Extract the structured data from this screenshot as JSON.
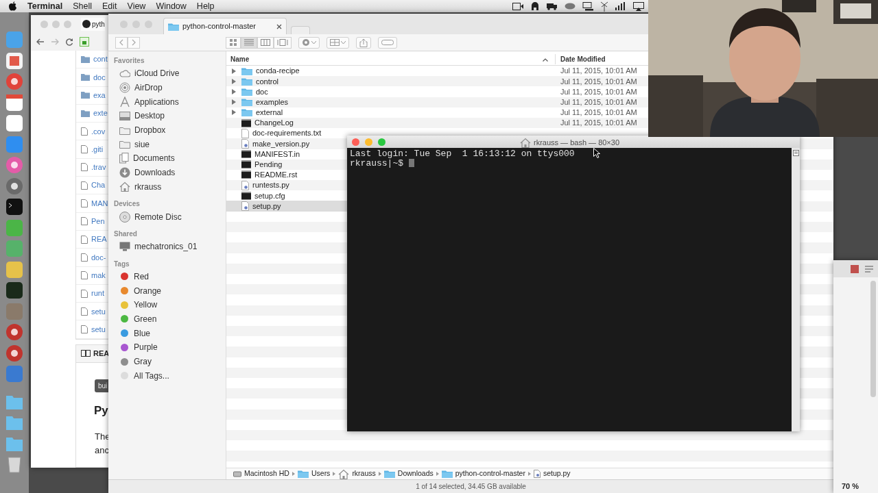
{
  "menu_bar": {
    "app": "Terminal",
    "items": [
      "Shell",
      "Edit",
      "View",
      "Window",
      "Help"
    ]
  },
  "browser": {
    "tab": "pyth",
    "files": [
      {
        "name": "cont",
        "kind": "folder"
      },
      {
        "name": "doc",
        "kind": "folder"
      },
      {
        "name": "exa",
        "kind": "folder"
      },
      {
        "name": "exte",
        "kind": "folder"
      },
      {
        "name": ".cov",
        "kind": "file"
      },
      {
        "name": ".giti",
        "kind": "file"
      },
      {
        "name": ".trav",
        "kind": "file"
      },
      {
        "name": "Cha",
        "kind": "file"
      },
      {
        "name": "MAN",
        "kind": "file"
      },
      {
        "name": "Pen",
        "kind": "file"
      },
      {
        "name": "REA",
        "kind": "file"
      },
      {
        "name": "doc-",
        "kind": "file"
      },
      {
        "name": "mak",
        "kind": "file"
      },
      {
        "name": "runt",
        "kind": "file"
      },
      {
        "name": "setu",
        "kind": "file"
      },
      {
        "name": "setu",
        "kind": "file"
      }
    ],
    "readme_heading": "REA",
    "badge": "bui",
    "heading": "Py",
    "paragraph_lines": [
      "The",
      "anc"
    ]
  },
  "finder": {
    "tab": "python-control-master",
    "sidebar": [
      {
        "heading": "Favorites",
        "items": [
          {
            "label": "iCloud Drive",
            "kind": "cloud"
          },
          {
            "label": "AirDrop",
            "kind": "airdrop"
          },
          {
            "label": "Applications",
            "kind": "apps"
          },
          {
            "label": "Desktop",
            "kind": "desktop"
          },
          {
            "label": "Dropbox",
            "kind": "folder"
          },
          {
            "label": "siue",
            "kind": "folder"
          },
          {
            "label": "Documents",
            "kind": "documents"
          },
          {
            "label": "Downloads",
            "kind": "downloads"
          },
          {
            "label": "rkrauss",
            "kind": "home"
          }
        ]
      },
      {
        "heading": "Devices",
        "items": [
          {
            "label": "Remote Disc",
            "kind": "disc"
          }
        ]
      },
      {
        "heading": "Shared",
        "items": [
          {
            "label": "mechatronics_01",
            "kind": "computer"
          }
        ]
      }
    ],
    "tags_heading": "Tags",
    "tags": [
      {
        "label": "Red",
        "color": "#d9342f"
      },
      {
        "label": "Orange",
        "color": "#e8892e"
      },
      {
        "label": "Yellow",
        "color": "#e8c23a"
      },
      {
        "label": "Green",
        "color": "#4cb842"
      },
      {
        "label": "Blue",
        "color": "#3a9be0"
      },
      {
        "label": "Purple",
        "color": "#a857d0"
      },
      {
        "label": "Gray",
        "color": "#8e8e8e"
      },
      {
        "label": "All Tags...",
        "color": "#dcdcdc"
      }
    ],
    "columns": [
      "Name",
      "Date Modified"
    ],
    "rows": [
      {
        "name": "conda-recipe",
        "kind": "folder",
        "date": "Jul 11, 2015, 10:01 AM",
        "selected": false
      },
      {
        "name": "control",
        "kind": "folder",
        "date": "Jul 11, 2015, 10:01 AM",
        "selected": false
      },
      {
        "name": "doc",
        "kind": "folder",
        "date": "Jul 11, 2015, 10:01 AM",
        "selected": false
      },
      {
        "name": "examples",
        "kind": "folder",
        "date": "Jul 11, 2015, 10:01 AM",
        "selected": false
      },
      {
        "name": "external",
        "kind": "folder",
        "date": "Jul 11, 2015, 10:01 AM",
        "selected": false
      },
      {
        "name": "ChangeLog",
        "kind": "exec",
        "date": "Jul 11, 2015, 10:01 AM",
        "selected": false
      },
      {
        "name": "doc-requirements.txt",
        "kind": "text",
        "selected": false
      },
      {
        "name": "make_version.py",
        "kind": "python",
        "selected": false
      },
      {
        "name": "MANIFEST.in",
        "kind": "exec",
        "selected": false
      },
      {
        "name": "Pending",
        "kind": "exec",
        "selected": false
      },
      {
        "name": "README.rst",
        "kind": "exec",
        "selected": false
      },
      {
        "name": "runtests.py",
        "kind": "python",
        "selected": false
      },
      {
        "name": "setup.cfg",
        "kind": "exec",
        "selected": false
      },
      {
        "name": "setup.py",
        "kind": "python",
        "selected": true
      }
    ],
    "path": [
      {
        "label": "Macintosh HD",
        "kind": "disk"
      },
      {
        "label": "Users",
        "kind": "folder"
      },
      {
        "label": "rkrauss",
        "kind": "home"
      },
      {
        "label": "Downloads",
        "kind": "folder"
      },
      {
        "label": "python-control-master",
        "kind": "folder"
      },
      {
        "label": "setup.py",
        "kind": "python"
      }
    ],
    "status": "1 of 14 selected, 34.45 GB available"
  },
  "terminal": {
    "title": "rkrauss — bash — 80×30",
    "lines": [
      "Last login: Tue Sep  1 16:13:12 on ttys000"
    ],
    "prompt": "rkrauss|~$ "
  },
  "side_window": {
    "zoom": "70 %"
  }
}
